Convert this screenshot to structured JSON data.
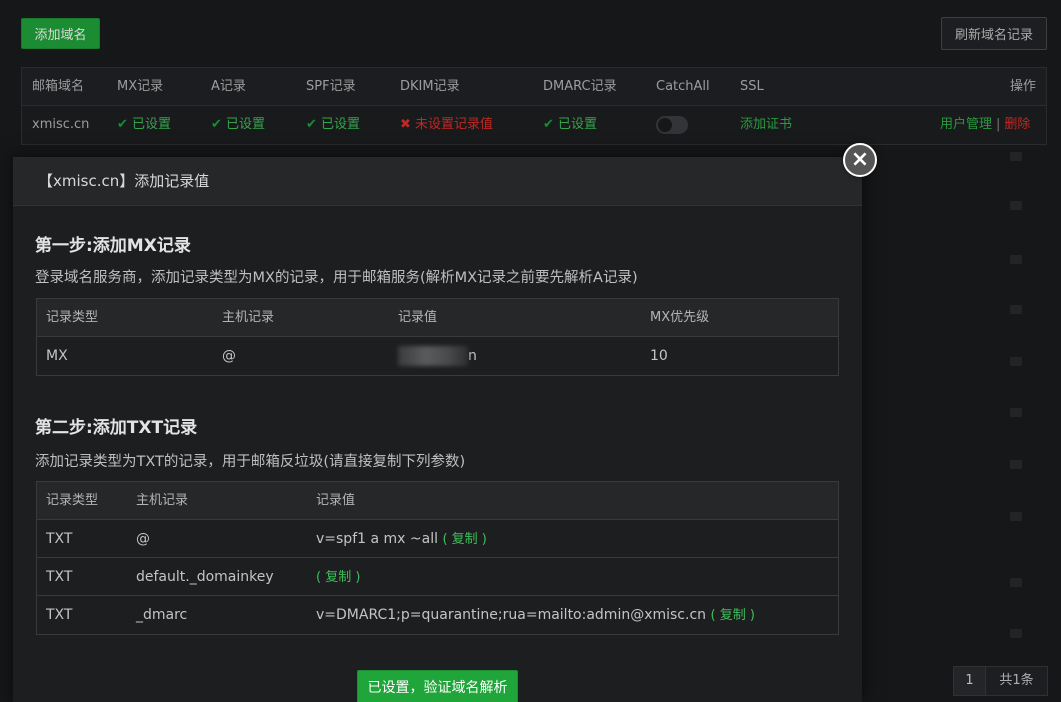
{
  "toolbar": {
    "add_domain_label": "添加域名",
    "refresh_label": "刷新域名记录"
  },
  "domain_table": {
    "headers": [
      "邮箱域名",
      "MX记录",
      "A记录",
      "SPF记录",
      "DKIM记录",
      "DMARC记录",
      "CatchAll",
      "SSL",
      "操作"
    ],
    "row": {
      "domain": "xmisc.cn",
      "mx": "已设置",
      "a": "已设置",
      "spf": "已设置",
      "dkim": "未设置记录值",
      "dmarc": "已设置",
      "catchall_enabled": false,
      "ssl_action": "添加证书",
      "user_manage": "用户管理",
      "separator": "|",
      "delete": "删除"
    }
  },
  "modal": {
    "title": "【xmisc.cn】添加记录值",
    "close_icon": "×",
    "step1": {
      "title": "第一步:添加MX记录",
      "desc": "登录域名服务商，添加记录类型为MX的记录，用于邮箱服务(解析MX记录之前要先解析A记录)",
      "headers": [
        "记录类型",
        "主机记录",
        "记录值",
        "MX优先级"
      ],
      "row": {
        "type": "MX",
        "host": "@",
        "value_suffix": "n",
        "priority": "10"
      }
    },
    "step2": {
      "title": "第二步:添加TXT记录",
      "desc": "添加记录类型为TXT的记录，用于邮箱反垃圾(请直接复制下列参数)",
      "headers": [
        "记录类型",
        "主机记录",
        "记录值"
      ],
      "rows": [
        {
          "type": "TXT",
          "host": "@",
          "value": "v=spf1 a mx ~all",
          "copy": "( 复制 )"
        },
        {
          "type": "TXT",
          "host": "default._domainkey",
          "value": "",
          "copy": "( 复制 )"
        },
        {
          "type": "TXT",
          "host": "_dmarc",
          "value": "v=DMARC1;p=quarantine;rua=mailto:admin@xmisc.cn",
          "copy": "( 复制 )"
        }
      ]
    },
    "verify_label": "已设置，验证域名解析"
  },
  "pager": {
    "current_page": "1",
    "total": "共1条"
  },
  "colors": {
    "accent_green": "#20a53a",
    "error_red": "#e0302c",
    "background": "#1b1c1e"
  },
  "icons": {
    "ok": "check-icon",
    "error": "cross-icon",
    "close": "close-icon"
  }
}
